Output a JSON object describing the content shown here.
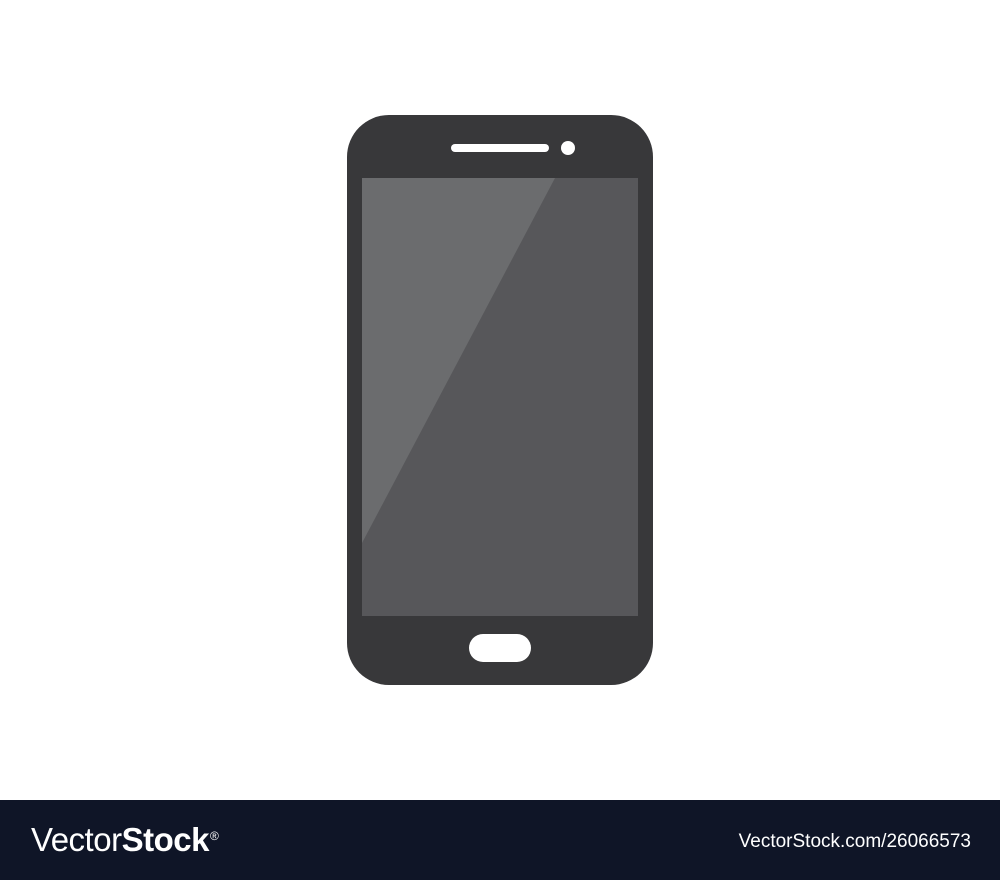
{
  "phone_illustration": {
    "icon": "smartphone-icon",
    "colors": {
      "body": "#38383a",
      "screen": "#57575a",
      "screen_glare": "#6b6c6e",
      "details": "#ffffff"
    }
  },
  "watermark": {
    "logo_part1": "Vector",
    "logo_part2": "Stock",
    "logo_mark": "®",
    "image_id_text": "VectorStock.com/26066573",
    "bar_color": "#0f1527"
  }
}
